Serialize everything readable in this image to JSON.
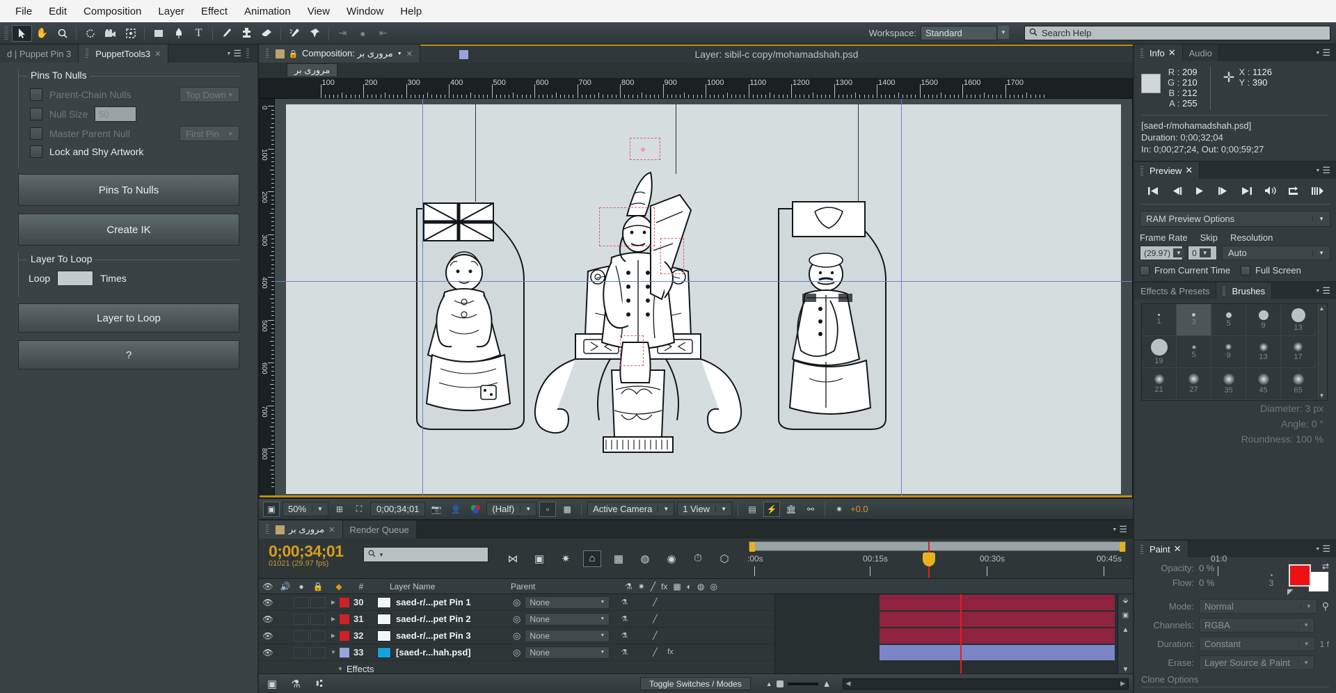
{
  "menu": {
    "items": [
      "File",
      "Edit",
      "Composition",
      "Layer",
      "Effect",
      "Animation",
      "View",
      "Window",
      "Help"
    ]
  },
  "toolbar": {
    "tools": [
      {
        "name": "selection-tool",
        "glyph": "➤",
        "selected": true
      },
      {
        "name": "hand-tool",
        "glyph": "✋",
        "selected": false
      },
      {
        "name": "zoom-tool",
        "glyph": "⌕",
        "selected": false
      },
      {
        "name": "rotation-tool",
        "glyph": "↻",
        "selected": false
      },
      {
        "name": "camera-tool",
        "glyph": "🎥",
        "selected": false
      },
      {
        "name": "pan-behind-tool",
        "glyph": "⬚",
        "selected": false
      },
      {
        "name": "shape-tool",
        "glyph": "■",
        "selected": false
      },
      {
        "name": "pen-tool",
        "glyph": "✒",
        "selected": false
      },
      {
        "name": "type-tool",
        "glyph": "T",
        "selected": false
      },
      {
        "name": "brush-tool",
        "glyph": "╱",
        "selected": false
      },
      {
        "name": "clone-stamp-tool",
        "glyph": "⚒",
        "selected": false
      },
      {
        "name": "eraser-tool",
        "glyph": "▱",
        "selected": false
      },
      {
        "name": "roto-brush-tool",
        "glyph": "✄",
        "selected": false
      },
      {
        "name": "puppet-pin-tool",
        "glyph": "📌",
        "selected": false
      }
    ],
    "workspace_label": "Workspace:",
    "workspace_value": "Standard",
    "search_placeholder": "Search Help"
  },
  "left_panel": {
    "tabs": [
      {
        "label": "d | Puppet Pin 3",
        "active": false
      },
      {
        "label": "PuppetTools3",
        "active": true,
        "closable": true
      }
    ],
    "pins_to_nulls": {
      "group_title": "Pins To Nulls",
      "rows": [
        {
          "label": "Parent-Chain Nulls",
          "enabled": false,
          "control": "dropdown",
          "value": "Top Down"
        },
        {
          "label": "Null Size",
          "enabled": false,
          "control": "number",
          "value": "50"
        },
        {
          "label": "Master Parent Null",
          "enabled": false,
          "control": "dropdown",
          "value": "First Pin"
        },
        {
          "label": "Lock and Shy Artwork",
          "enabled": true,
          "control": "none",
          "value": ""
        }
      ]
    },
    "buttons": [
      {
        "label": "Pins To Nulls"
      },
      {
        "label": "Create IK"
      }
    ],
    "layer_to_loop": {
      "group_title": "Layer To Loop",
      "prefix": "Loop",
      "value": "",
      "suffix": "Times"
    },
    "loop_button": "Layer to Loop",
    "help_button": "?"
  },
  "comp_panel": {
    "tabs": [
      {
        "label": "Composition: مرورى بر",
        "active": true,
        "closable": true
      },
      {
        "label": "Layer: sibil-c copy/mohamadshah.psd",
        "active": false
      }
    ],
    "breadcrumb": "مرورى بر",
    "h_ruler_labels": [
      "100",
      "200",
      "300",
      "400",
      "500",
      "600",
      "700",
      "800",
      "900",
      "1000",
      "1100",
      "1200",
      "1300",
      "1400",
      "1500",
      "1600",
      "1700"
    ],
    "v_ruler_labels": [
      "0",
      "100",
      "200",
      "300",
      "400",
      "500",
      "600",
      "700",
      "800"
    ],
    "toolbar": {
      "zoom": "50%",
      "time": "0;00;34;01",
      "resolution": "(Half)",
      "view_camera": "Active Camera",
      "view_count": "1 View",
      "exposure": "+0.0"
    }
  },
  "timeline": {
    "tabs": [
      {
        "label": "مرورى بر",
        "active": true,
        "closable": true
      },
      {
        "label": "Render Queue",
        "active": false
      }
    ],
    "current_time": "0;00;34;01",
    "frame_info": "01021 (29.97 fps)",
    "search_placeholder": "",
    "columns": [
      "#",
      "Layer Name",
      "Parent"
    ],
    "ruler_labels": [
      ":00s",
      "00:15s",
      "00:30s",
      "00:45s",
      "01:0"
    ],
    "layers": [
      {
        "index": "30",
        "name": "saed-r/...pet Pin 1",
        "parent": "None",
        "color": "#cf2026",
        "thumb": "#f3f6f7",
        "expanded": false,
        "bar_color": "#8e2340"
      },
      {
        "index": "31",
        "name": "saed-r/...pet Pin 2",
        "parent": "None",
        "color": "#cf2026",
        "thumb": "#f3f6f7",
        "expanded": false,
        "bar_color": "#8e2340"
      },
      {
        "index": "32",
        "name": "saed-r/...pet Pin 3",
        "parent": "None",
        "color": "#cf2026",
        "thumb": "#f3f6f7",
        "expanded": false,
        "bar_color": "#8e2340"
      },
      {
        "index": "33",
        "name": "[saed-r...hah.psd]",
        "parent": "None",
        "color": "#9aa3dc",
        "thumb": "#17a0d8",
        "expanded": true,
        "bar_color": "#7b85c6"
      }
    ],
    "sub_row_label": "Effects",
    "toggle_switches_label": "Toggle Switches / Modes"
  },
  "info_panel": {
    "tabs": [
      {
        "label": "Info",
        "active": true,
        "closable": true
      },
      {
        "label": "Audio",
        "active": false
      }
    ],
    "r_label": "R :",
    "r_value": "209",
    "g_label": "G :",
    "g_value": "210",
    "b_label": "B :",
    "b_value": "212",
    "a_label": "A :",
    "a_value": "255",
    "x_label": "X :",
    "x_value": "1126",
    "y_label": "Y :",
    "y_value": "390",
    "swatch_color": "#d1d6d8",
    "source_name": "[saed-r/mohamadshah.psd]",
    "duration": "Duration: 0;00;32;04",
    "in_out": "In: 0;00;27;24, Out: 0;00;59;27"
  },
  "preview_panel": {
    "tabs": [
      {
        "label": "Preview",
        "active": true,
        "closable": true
      }
    ],
    "buttons": [
      {
        "name": "first-frame-button",
        "glyph": "⏮"
      },
      {
        "name": "previous-frame-button",
        "glyph": "◀❘"
      },
      {
        "name": "play-button",
        "glyph": "▶"
      },
      {
        "name": "next-frame-button",
        "glyph": "❘▶"
      },
      {
        "name": "last-frame-button",
        "glyph": "⏭"
      },
      {
        "name": "audio-toggle-button",
        "glyph": "🔊"
      },
      {
        "name": "loop-button",
        "glyph": "↻"
      },
      {
        "name": "ram-preview-button",
        "glyph": "⏩"
      }
    ],
    "options_label": "RAM Preview Options",
    "frame_rate_label": "Frame Rate",
    "frame_rate_value": "(29.97)",
    "skip_label": "Skip",
    "skip_value": "0",
    "resolution_label": "Resolution",
    "resolution_value": "Auto",
    "from_current_time": "From Current Time",
    "full_screen": "Full Screen"
  },
  "brushes_panel": {
    "tabs": [
      {
        "label": "Effects & Presets",
        "active": false
      },
      {
        "label": "Brushes",
        "active": true
      }
    ],
    "cells": [
      {
        "size": "1",
        "dot": 3,
        "soft": false,
        "selected": false
      },
      {
        "size": "3",
        "dot": 5,
        "soft": false,
        "selected": true
      },
      {
        "size": "5",
        "dot": 8,
        "soft": false,
        "selected": false
      },
      {
        "size": "9",
        "dot": 14,
        "soft": false,
        "selected": false
      },
      {
        "size": "13",
        "dot": 20,
        "soft": false,
        "selected": false
      },
      {
        "size": "19",
        "dot": 24,
        "soft": false,
        "selected": false
      },
      {
        "size": "5",
        "dot": 6,
        "soft": true,
        "selected": false
      },
      {
        "size": "9",
        "dot": 9,
        "soft": true,
        "selected": false
      },
      {
        "size": "13",
        "dot": 12,
        "soft": true,
        "selected": false
      },
      {
        "size": "17",
        "dot": 13,
        "soft": true,
        "selected": false
      },
      {
        "size": "21",
        "dot": 14,
        "soft": true,
        "selected": false
      },
      {
        "size": "27",
        "dot": 15,
        "soft": true,
        "selected": false
      },
      {
        "size": "35",
        "dot": 16,
        "soft": true,
        "selected": false
      },
      {
        "size": "45",
        "dot": 16,
        "soft": true,
        "selected": false
      },
      {
        "size": "65",
        "dot": 16,
        "soft": true,
        "selected": false
      }
    ],
    "diameter": "Diameter: 3 px",
    "angle": "Angle: 0 °",
    "roundness": "Roundness: 100 %"
  },
  "paint_panel": {
    "tabs": [
      {
        "label": "Paint",
        "active": true,
        "closable": true
      }
    ],
    "opacity_label": "Opacity:",
    "opacity_value": "0 %",
    "flow_label": "Flow:",
    "flow_value": "0 %",
    "brush_preview_value": "3",
    "mode_label": "Mode:",
    "mode_value": "Normal",
    "channels_label": "Channels:",
    "channels_value": "RGBA",
    "duration_label": "Duration:",
    "duration_value": "Constant",
    "duration_frames": "1 f",
    "erase_label": "Erase:",
    "erase_value": "Layer Source & Paint",
    "clone_options": "Clone Options",
    "foreground_color": "#ee1111",
    "background_color": "#ffffff"
  }
}
